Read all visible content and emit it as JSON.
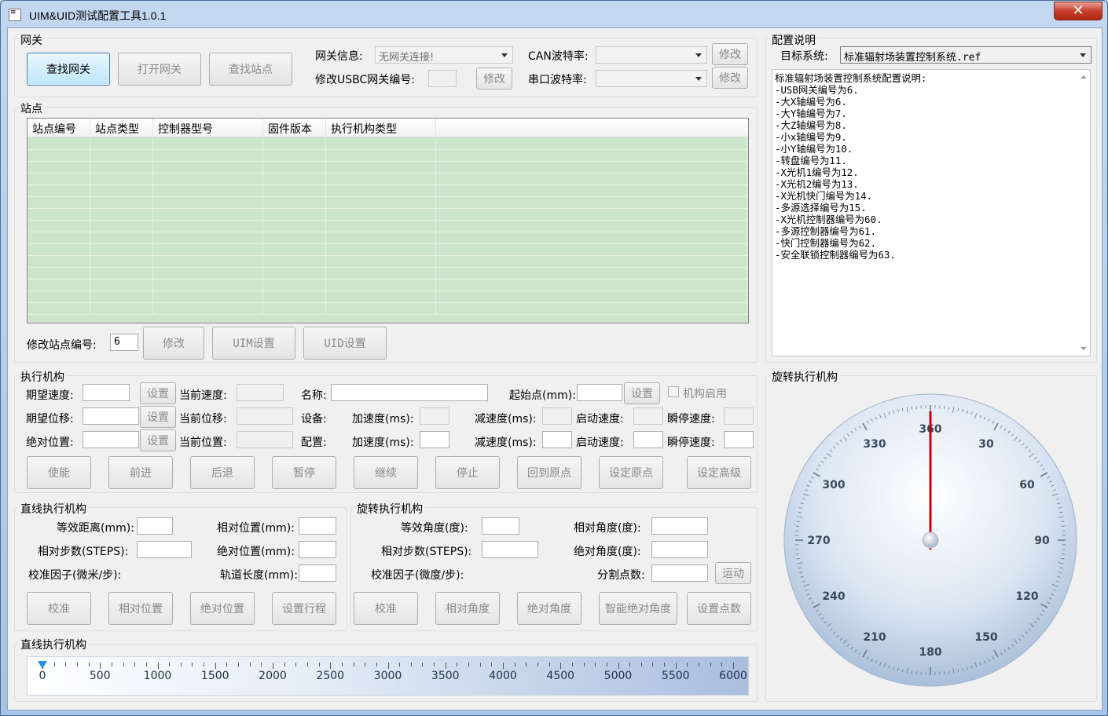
{
  "window": {
    "title": "UIM&UID测试配置工具1.0.1",
    "close": "✕"
  },
  "gateway": {
    "group_title": "网关",
    "find_gateway": "查找网关",
    "open_gateway": "打开网关",
    "find_station": "查找站点",
    "info_label": "网关信息:",
    "info_value": "无网关连接!",
    "usbc_label": "修改USBC网关编号:",
    "modify": "修改",
    "can_label": "CAN波特率:",
    "serial_label": "串口波特率:",
    "modify2": "修改",
    "modify3": "修改"
  },
  "station": {
    "group_title": "站点",
    "columns": [
      "站点编号",
      "站点类型",
      "控制器型号",
      "固件版本",
      "执行机构类型"
    ],
    "modify_label": "修改站点编号:",
    "modify_value": "6",
    "modify_btn": "修改",
    "uim_btn": "UIM设置",
    "uid_btn": "UID设置"
  },
  "config": {
    "group_title": "配置说明",
    "target_label": "目标系统:",
    "target_value": "标准辐射场装置控制系统.ref",
    "lines": [
      "标准辐射场装置控制系统配置说明:",
      "-USB网关编号为6.",
      "-大X轴编号为6.",
      "-大Y轴编号为7.",
      "-大Z轴编号为8.",
      "-小x轴编号为9.",
      "-小Y轴编号为10.",
      "-转盘编号为11.",
      "-X光机1编号为12.",
      "-X光机2编号为13.",
      "-X光机快门编号为14.",
      "-多源选择编号为15.",
      "-X光机控制器编号为60.",
      "-多源控制器编号为61.",
      "-快门控制器编号为62.",
      "-安全联锁控制器编号为63."
    ]
  },
  "actuator": {
    "group_title": "执行机构",
    "expect_speed": "期望速度:",
    "expect_pos": "期望位移:",
    "abs_pos": "绝对位置:",
    "set": "设置",
    "cur_speed": "当前速度:",
    "cur_pos": "当前位移:",
    "cur_abspos": "当前位置:",
    "name": "名称:",
    "device": "设备:",
    "config": "配置:",
    "start_point": "起始点(mm):",
    "set2": "设置",
    "enable_chk": "机构启用",
    "accel": "加速度(ms):",
    "decel": "减速度(ms):",
    "start_speed": "启动速度:",
    "stop_speed": "瞬停速度:",
    "buttons": [
      "使能",
      "前进",
      "后退",
      "暂停",
      "继续",
      "停止",
      "回到原点",
      "设定原点",
      "设定高级"
    ]
  },
  "linear": {
    "group_title": "直线执行机构",
    "eq_dist": "等效距离(mm):",
    "rel_steps": "相对步数(STEPS):",
    "calib": "校准因子(微米/步):",
    "rel_pos": "相对位置(mm):",
    "abs_pos": "绝对位置(mm):",
    "track_len": "轨道长度(mm):",
    "buttons": [
      "校准",
      "相对位置",
      "绝对位置",
      "设置行程"
    ]
  },
  "rotary": {
    "group_title": "旋转执行机构",
    "eq_angle": "等效角度(度):",
    "rel_steps": "相对步数(STEPS):",
    "calib": "校准因子(微度/步):",
    "rel_angle": "相对角度(度):",
    "abs_angle": "绝对角度(度):",
    "divisions": "分割点数:",
    "run": "运动",
    "buttons": [
      "校准",
      "相对角度",
      "绝对角度",
      "智能绝对角度",
      "设置点数"
    ]
  },
  "slider": {
    "group_title": "直线执行机构",
    "min": 0,
    "max": 6000,
    "value": 0,
    "labels": [
      "0",
      "500",
      "1000",
      "1500",
      "2000",
      "2500",
      "3000",
      "3500",
      "4000",
      "4500",
      "5000",
      "5500",
      "6000"
    ]
  },
  "dial": {
    "group_title": "旋转执行机构",
    "value": 0,
    "labels": [
      "360",
      "30",
      "60",
      "90",
      "120",
      "150",
      "180",
      "210",
      "240",
      "270",
      "300",
      "330"
    ],
    "needle_color": "#cc0000"
  }
}
